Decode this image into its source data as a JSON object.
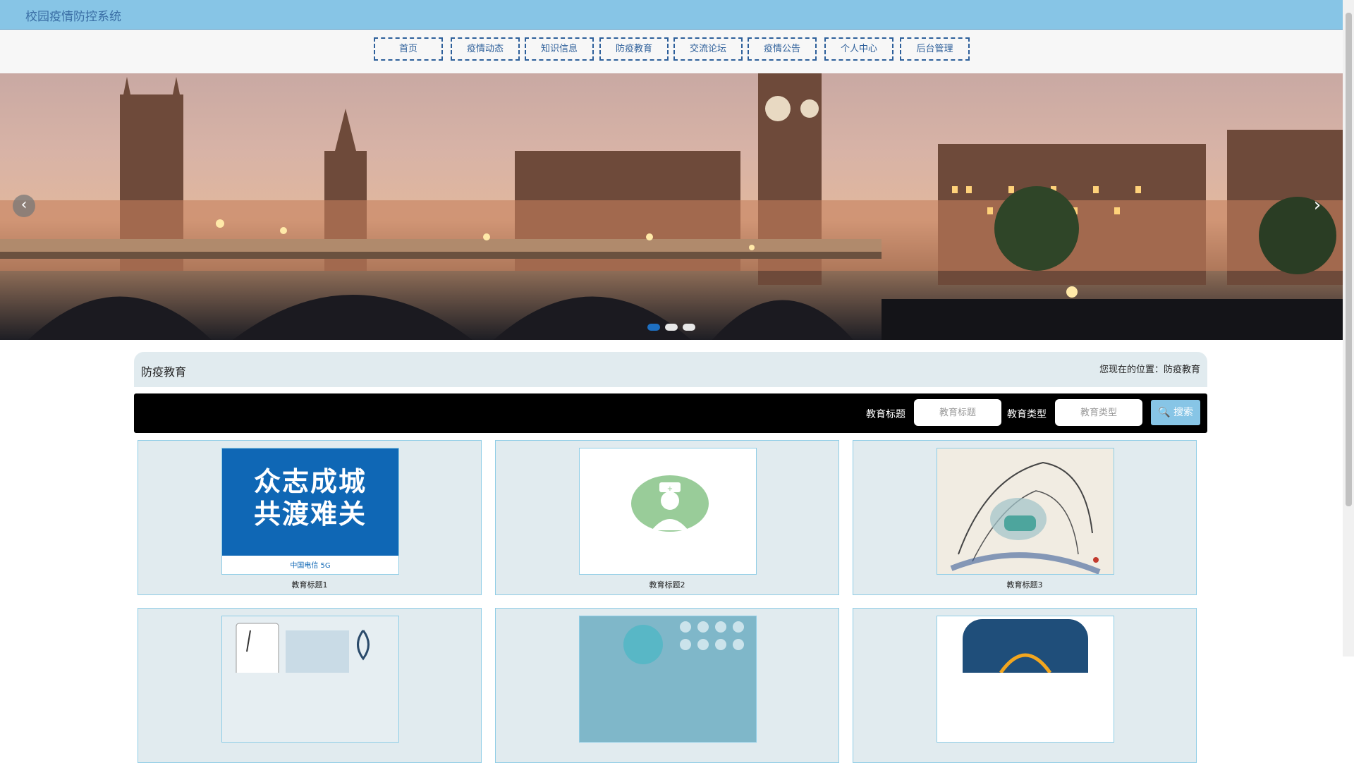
{
  "header": {
    "title": "校园疫情防控系统"
  },
  "nav": {
    "items": [
      {
        "label": "首页"
      },
      {
        "label": "疫情动态"
      },
      {
        "label": "知识信息"
      },
      {
        "label": "防疫教育"
      },
      {
        "label": "交流论坛"
      },
      {
        "label": "疫情公告"
      },
      {
        "label": "个人中心"
      },
      {
        "label": "后台管理"
      }
    ]
  },
  "banner": {
    "slide_count": 3,
    "active_slide": 1
  },
  "section": {
    "title": "防疫教育",
    "breadcrumb": "您现在的位置：防疫教育"
  },
  "search": {
    "title_label": "教育标题",
    "title_placeholder": "教育标题",
    "type_label": "教育类型",
    "type_placeholder": "教育类型",
    "button_label": "搜索"
  },
  "cards": [
    {
      "title": "教育标题1",
      "image_text_line1": "众志成城",
      "image_text_line2": "共渡难关",
      "image_footer": "中国电信 5G"
    },
    {
      "title": "教育标题2"
    },
    {
      "title": "教育标题3"
    },
    {
      "title": ""
    },
    {
      "title": ""
    },
    {
      "title": ""
    }
  ],
  "colors": {
    "header_bg": "#87c5e6",
    "nav_border": "#2d5f9a",
    "section_bg": "#e1ebef",
    "search_bar_bg": "#000000",
    "search_button": "#87c5e6",
    "card_border": "#8fcde6",
    "card_poster_blue": "#0f67b5",
    "nurse_icon_green": "#99cc99"
  }
}
